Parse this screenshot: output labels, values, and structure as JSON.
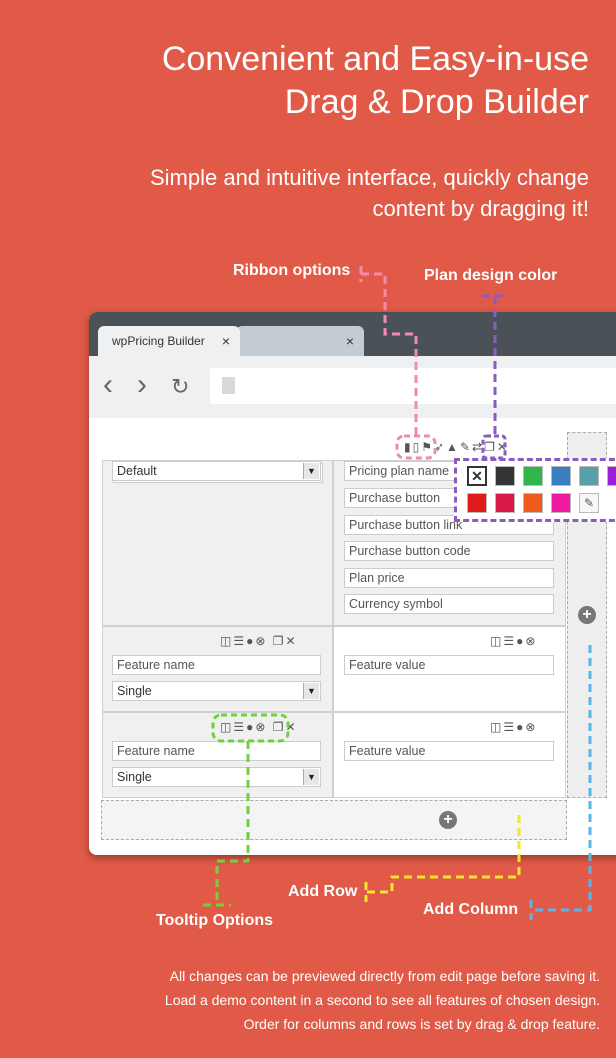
{
  "hero": {
    "title_line1": "Convenient and Easy-in-use",
    "title_line2": "Drag & Drop Builder",
    "subtitle_line1": "Simple and intuitive interface, quickly change",
    "subtitle_line2": "content by dragging it!"
  },
  "callouts": {
    "ribbon": "Ribbon options",
    "plan_color": "Plan design color",
    "add_row": "Add Row",
    "add_column": "Add Column",
    "tooltip": "Tooltip Options"
  },
  "browser": {
    "tab_active": "wpPricing Builder",
    "tab_close": "×",
    "tab2_close": "×",
    "back_icon": "‹",
    "forward_icon": "›",
    "reload_icon": "↻"
  },
  "builder": {
    "design_select": "Default",
    "plan_fields": [
      "Pricing plan name",
      "Purchase button",
      "Purchase button link",
      "Purchase button code",
      "Plan price",
      "Currency symbol"
    ],
    "rows": [
      {
        "feature_name": "Feature name",
        "type_select": "Single",
        "feature_value": "Feature value"
      },
      {
        "feature_name": "Feature name",
        "type_select": "Single",
        "feature_value": "Feature value"
      }
    ],
    "add_symbol": "+"
  },
  "palette": {
    "colors": [
      "#333333",
      "#2fb74a",
      "#3a7fc1",
      "#5a9fa8",
      "#9b1fd6",
      "#e01a1a",
      "#d9184a",
      "#f05a1a",
      "#f01aa0"
    ]
  },
  "accents": {
    "ribbon": "#f08ab4",
    "plan_color": "#8a5cc0",
    "tooltip": "#6fd23a",
    "add_row": "#f5e62a",
    "add_column": "#5ab4e8"
  },
  "footer": {
    "line1": "All changes can be previewed directly from edit page before saving it.",
    "line2": "Load a demo content in a second to see all features of chosen design.",
    "line3": "Order for columns and rows is set by drag & drop feature."
  }
}
